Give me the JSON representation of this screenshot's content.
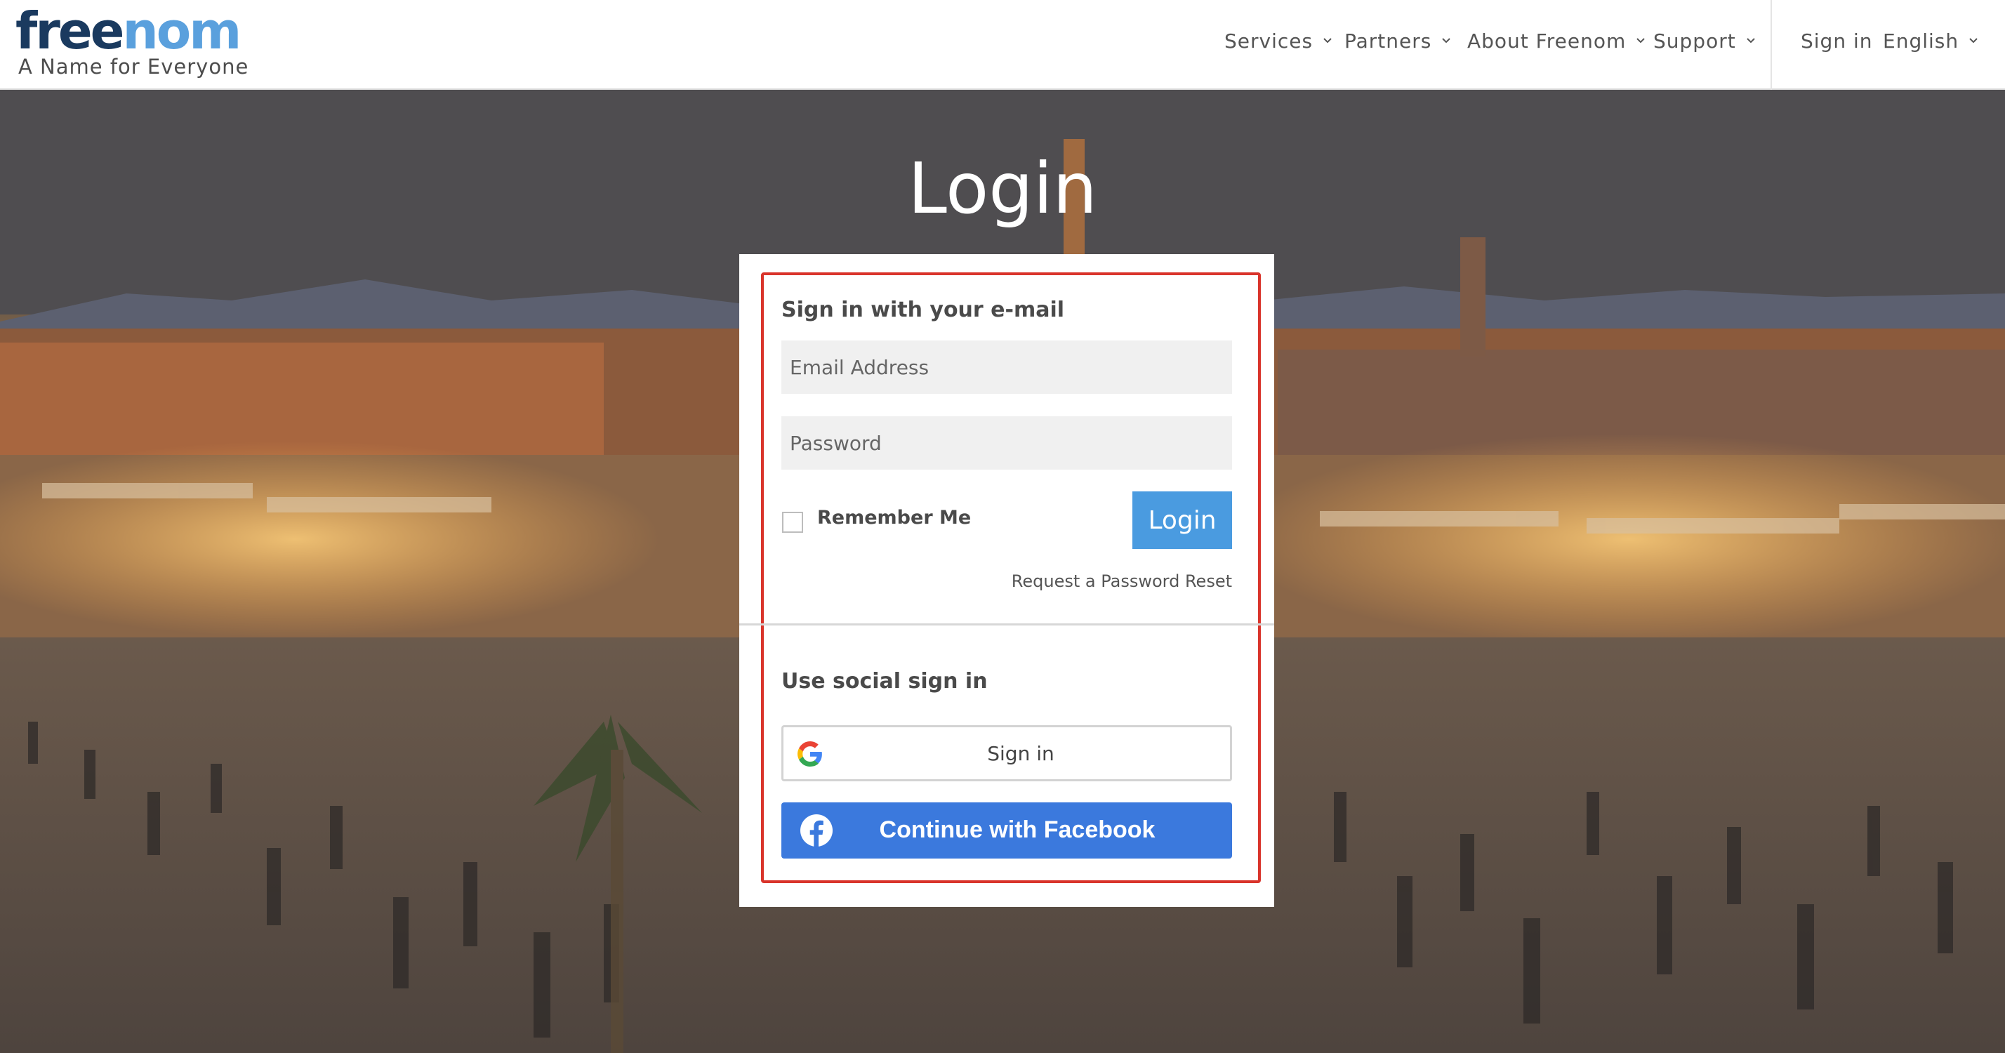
{
  "brand": {
    "logo_part1": "free",
    "logo_part2": "nom",
    "tagline": "A Name for Everyone"
  },
  "nav": {
    "items": [
      {
        "label": "Services"
      },
      {
        "label": "Partners"
      },
      {
        "label": "About Freenom"
      },
      {
        "label": "Support"
      }
    ],
    "signin_label": "Sign in",
    "language_label": "English"
  },
  "page": {
    "title": "Login"
  },
  "login_form": {
    "heading": "Sign in with your e-mail",
    "email_placeholder": "Email Address",
    "password_placeholder": "Password",
    "remember_label": "Remember Me",
    "login_button": "Login",
    "reset_link": "Request a Password Reset"
  },
  "social": {
    "heading": "Use social sign in",
    "google_label": "Sign in",
    "facebook_label": "Continue with Facebook"
  },
  "colors": {
    "accent_blue": "#4a9be0",
    "facebook_blue": "#3b79dd",
    "highlight_red": "#d9342b",
    "logo_dark": "#1a3a5f",
    "logo_light": "#5aa0dd"
  },
  "icons": [
    "chevron-down-icon",
    "google-icon",
    "facebook-icon",
    "checkbox"
  ]
}
